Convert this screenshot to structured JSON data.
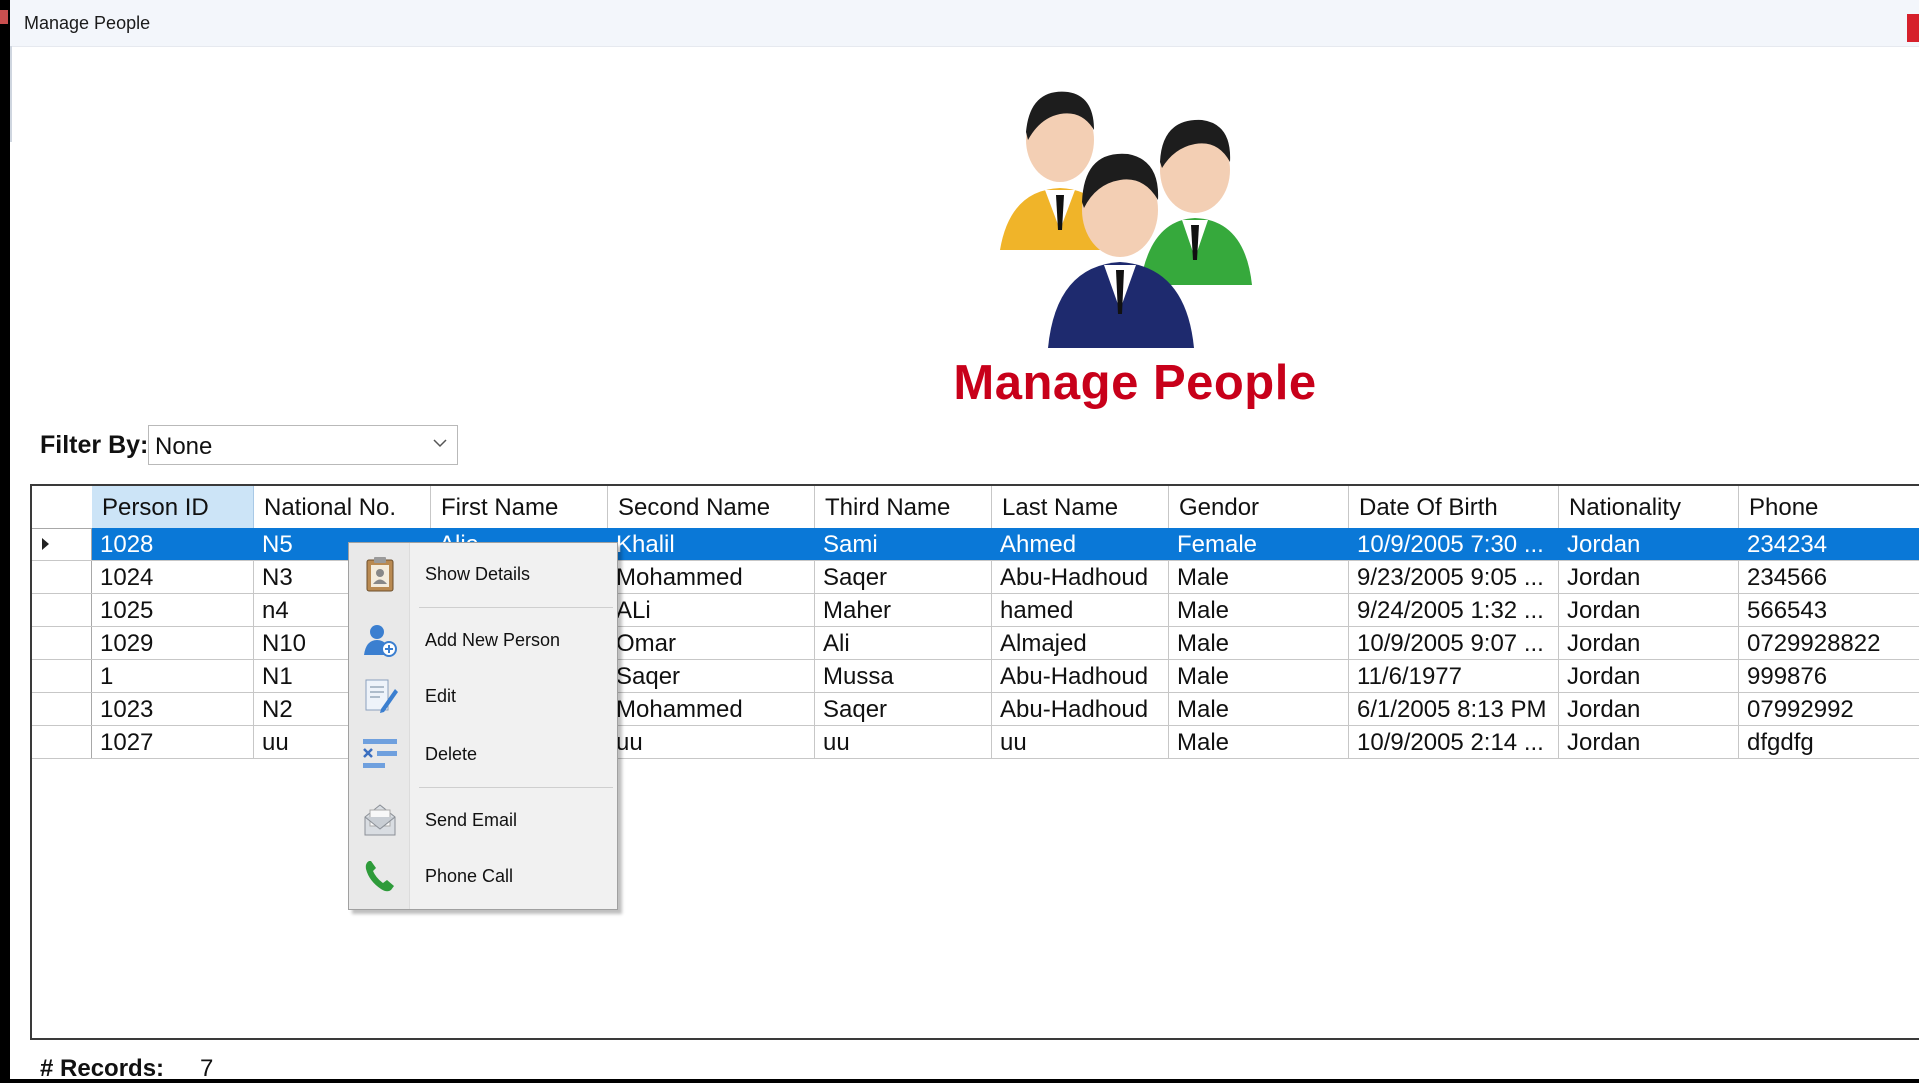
{
  "window": {
    "title": "Manage People"
  },
  "header": {
    "title": "Manage People"
  },
  "filter": {
    "label": "Filter By:",
    "value": "None"
  },
  "table": {
    "columns": [
      "Person ID",
      "National No.",
      "First Name",
      "Second Name",
      "Third Name",
      "Last Name",
      "Gendor",
      "Date Of Birth",
      "Nationality",
      "Phone"
    ],
    "rows": [
      [
        "1028",
        "N5",
        "Alia",
        "Khalil",
        "Sami",
        "Ahmed",
        "Female",
        "10/9/2005 7:30 ...",
        "Jordan",
        "234234"
      ],
      [
        "1024",
        "N3",
        "",
        "Mohammed",
        "Saqer",
        "Abu-Hadhoud",
        "Male",
        "9/23/2005 9:05 ...",
        "Jordan",
        "234566"
      ],
      [
        "1025",
        "n4",
        "",
        "ALi",
        "Maher",
        "hamed",
        "Male",
        "9/24/2005 1:32 ...",
        "Jordan",
        "566543"
      ],
      [
        "1029",
        "N10",
        "",
        "Omar",
        "Ali",
        "Almajed",
        "Male",
        "10/9/2005 9:07 ...",
        "Jordan",
        "0729928822"
      ],
      [
        "1",
        "N1",
        "",
        "Saqer",
        "Mussa",
        "Abu-Hadhoud",
        "Male",
        "11/6/1977",
        "Jordan",
        "999876"
      ],
      [
        "1023",
        "N2",
        "",
        "Mohammed",
        "Saqer",
        "Abu-Hadhoud",
        "Male",
        "6/1/2005 8:13 PM",
        "Jordan",
        "07992992"
      ],
      [
        "1027",
        "uu",
        "",
        "uu",
        "uu",
        "uu",
        "Male",
        "10/9/2005 2:14 ...",
        "Jordan",
        "dfgdfg"
      ]
    ],
    "selected_row": 0
  },
  "context_menu": {
    "items": [
      {
        "label": "Show Details",
        "icon": "clipboard-person-icon"
      },
      {
        "label": "Add New Person",
        "icon": "add-person-icon"
      },
      {
        "label": "Edit",
        "icon": "edit-document-icon"
      },
      {
        "label": "Delete",
        "icon": "delete-icon"
      },
      {
        "label": "Send Email",
        "icon": "email-icon"
      },
      {
        "label": "Phone Call",
        "icon": "phone-icon"
      }
    ]
  },
  "footer": {
    "records_label": "# Records:",
    "records_value": "7"
  },
  "colors": {
    "title_red": "#c8001a",
    "selection_blue": "#0a78d7",
    "header_highlight": "#cce4f7"
  }
}
